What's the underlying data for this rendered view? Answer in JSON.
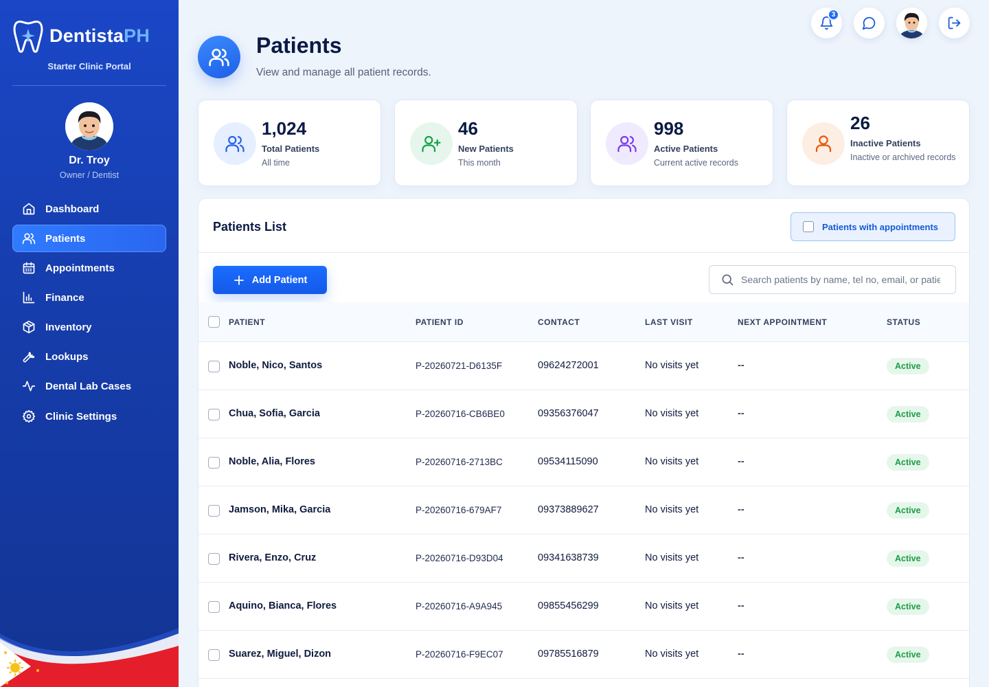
{
  "app": {
    "brand_main": "Dentista",
    "brand_accent": "PH",
    "portal": "Starter Clinic Portal"
  },
  "user": {
    "name": "Dr. Troy",
    "role": "Owner / Dentist"
  },
  "nav": [
    {
      "label": "Dashboard",
      "icon": "home-icon"
    },
    {
      "label": "Patients",
      "icon": "users-icon",
      "active": true
    },
    {
      "label": "Appointments",
      "icon": "calendar-icon"
    },
    {
      "label": "Finance",
      "icon": "bar-chart-icon"
    },
    {
      "label": "Inventory",
      "icon": "box-icon"
    },
    {
      "label": "Lookups",
      "icon": "wrench-icon"
    },
    {
      "label": "Dental Lab Cases",
      "icon": "activity-icon"
    },
    {
      "label": "Clinic Settings",
      "icon": "gear-icon"
    }
  ],
  "topbar": {
    "notification_count": "3"
  },
  "header": {
    "title": "Patients",
    "subtitle": "View and manage all patient records."
  },
  "stats": [
    {
      "value": "1,024",
      "label": "Total Patients",
      "note": "All time",
      "color": "#2563eb"
    },
    {
      "value": "46",
      "label": "New Patients",
      "note": "This month",
      "color": "#16a34a"
    },
    {
      "value": "998",
      "label": "Active Patients",
      "note": "Current active records",
      "color": "#7c3aed"
    },
    {
      "value": "26",
      "label": "Inactive Patients",
      "note": "Inactive or archived records",
      "color": "#ea580c"
    }
  ],
  "list": {
    "title": "Patients List",
    "filter_label": "Patients with appointments",
    "add_label": "Add Patient",
    "search_placeholder": "Search patients by name, tel no, email, or patient ID",
    "columns": [
      "PATIENT",
      "PATIENT ID",
      "CONTACT",
      "LAST VISIT",
      "NEXT APPOINTMENT",
      "STATUS"
    ],
    "rows": [
      {
        "name": "Noble, Nico, Santos",
        "id": "P-20260721-D6135F",
        "contact": "09624272001",
        "last_visit": "No visits yet",
        "next": "--",
        "status": "Active"
      },
      {
        "name": "Chua, Sofia, Garcia",
        "id": "P-20260716-CB6BE0",
        "contact": "09356376047",
        "last_visit": "No visits yet",
        "next": "--",
        "status": "Active"
      },
      {
        "name": "Noble, Alia, Flores",
        "id": "P-20260716-2713BC",
        "contact": "09534115090",
        "last_visit": "No visits yet",
        "next": "--",
        "status": "Active"
      },
      {
        "name": "Jamson, Mika, Garcia",
        "id": "P-20260716-679AF7",
        "contact": "09373889627",
        "last_visit": "No visits yet",
        "next": "--",
        "status": "Active"
      },
      {
        "name": "Rivera, Enzo, Cruz",
        "id": "P-20260716-D93D04",
        "contact": "09341638739",
        "last_visit": "No visits yet",
        "next": "--",
        "status": "Active"
      },
      {
        "name": "Aquino, Bianca, Flores",
        "id": "P-20260716-A9A945",
        "contact": "09855456299",
        "last_visit": "No visits yet",
        "next": "--",
        "status": "Active"
      },
      {
        "name": "Suarez, Miguel, Dizon",
        "id": "P-20260716-F9EC07",
        "contact": "09785516879",
        "last_visit": "No visits yet",
        "next": "--",
        "status": "Active"
      }
    ]
  },
  "colors": {
    "sidebar": "#1a47c7",
    "accent": "#1a6dff",
    "active_badge": "#1d9b48"
  }
}
